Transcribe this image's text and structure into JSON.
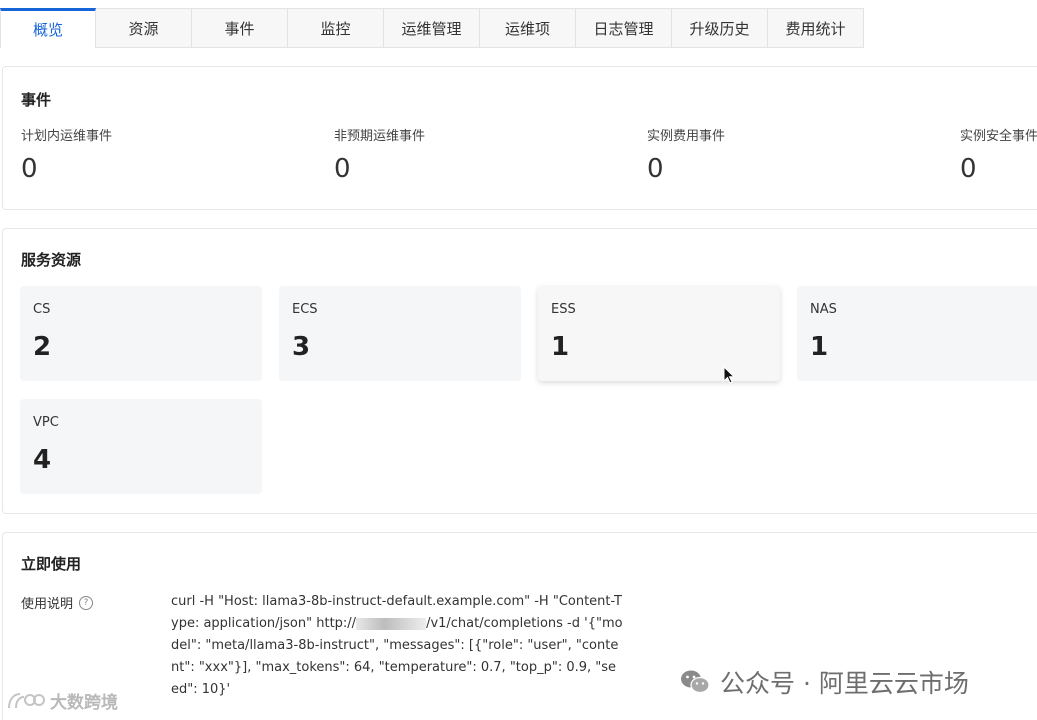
{
  "tabs": [
    {
      "label": "概览",
      "active": true
    },
    {
      "label": "资源"
    },
    {
      "label": "事件"
    },
    {
      "label": "监控"
    },
    {
      "label": "运维管理"
    },
    {
      "label": "运维项"
    },
    {
      "label": "日志管理"
    },
    {
      "label": "升级历史"
    },
    {
      "label": "费用统计"
    }
  ],
  "events": {
    "title": "事件",
    "items": [
      {
        "label": "计划内运维事件",
        "value": "0"
      },
      {
        "label": "非预期运维事件",
        "value": "0"
      },
      {
        "label": "实例费用事件",
        "value": "0"
      },
      {
        "label": "实例安全事件",
        "value": "0"
      }
    ]
  },
  "resources": {
    "title": "服务资源",
    "items": [
      {
        "name": "CS",
        "count": "2"
      },
      {
        "name": "ECS",
        "count": "3"
      },
      {
        "name": "ESS",
        "count": "1"
      },
      {
        "name": "NAS",
        "count": "1"
      },
      {
        "name": "VPC",
        "count": "4"
      }
    ]
  },
  "usage": {
    "title": "立即使用",
    "label": "使用说明",
    "code_prefix": "curl -H \"Host: llama3-8b-instruct-default.example.com\" -H \"Content-Type: application/json\" http://",
    "code_suffix": "/v1/chat/completions -d '{\"model\": \"meta/llama3-8b-instruct\", \"messages\": [{\"role\": \"user\", \"content\": \"xxx\"}], \"max_tokens\": 64, \"temperature\": 0.7, \"top_p\": 0.9, \"seed\": 10}'"
  },
  "watermarks": {
    "right": "公众号 · 阿里云云市场",
    "left": "大数跨境"
  },
  "colors": {
    "accent": "#1565d8",
    "card_bg": "#f5f6f7"
  }
}
